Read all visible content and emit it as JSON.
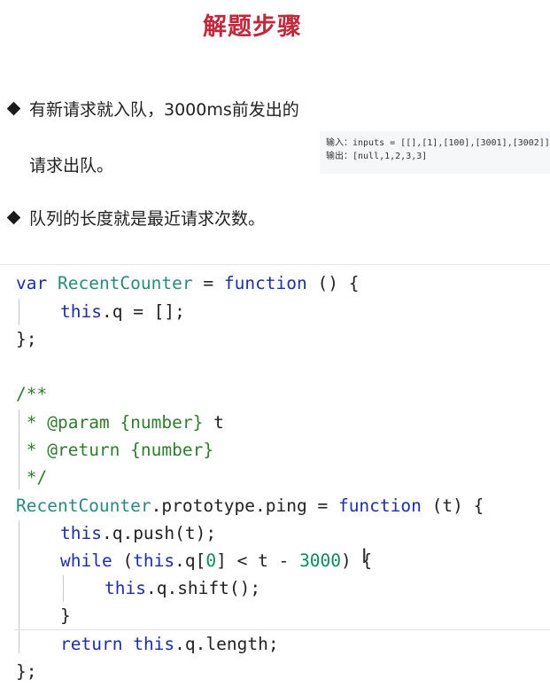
{
  "title": "解题步骤",
  "bullets": [
    {
      "line1": "有新请求就入队，3000ms前发出的",
      "line2": "请求出队。"
    },
    {
      "line1": "队列的长度就是最近请求次数。"
    }
  ],
  "example": {
    "input": "输入：inputs = [[],[1],[100],[3001],[3002]]",
    "output": "输出：[null,1,2,3,3]"
  },
  "code": {
    "l1": {
      "a": "var",
      "b": "RecentCounter",
      "c": " = ",
      "d": "function",
      "e": " () {"
    },
    "l2": {
      "a": "this",
      "b": ".q = [];"
    },
    "l3": "};",
    "l5": "/**",
    "l6": {
      "a": " * ",
      "b": "@param",
      "c": " {number}",
      "d": " t"
    },
    "l7": {
      "a": " * ",
      "b": "@return",
      "c": " {number}"
    },
    "l8": " */",
    "l9": {
      "a": "RecentCounter",
      "b": ".prototype.ping = ",
      "c": "function",
      "d": " (t) {"
    },
    "l10": {
      "a": "this",
      "b": ".q.push(t);"
    },
    "l11": {
      "a": "while",
      "b": " (",
      "c": "this",
      "d": ".q[",
      "e": "0",
      "f": "] < t - ",
      "g": "3000",
      "h": ") {"
    },
    "l12": {
      "a": "this",
      "b": ".q.shift();"
    },
    "l13": "}",
    "l14": {
      "a": "return",
      "b": " ",
      "c": "this",
      "d": ".q.length;"
    },
    "l15": "};"
  },
  "colors": {
    "title": "#c0283b",
    "keyword": "#1d2fa3",
    "class": "#2a8a7c",
    "comment": "#2f7d2f",
    "number": "#0d8a5a"
  }
}
